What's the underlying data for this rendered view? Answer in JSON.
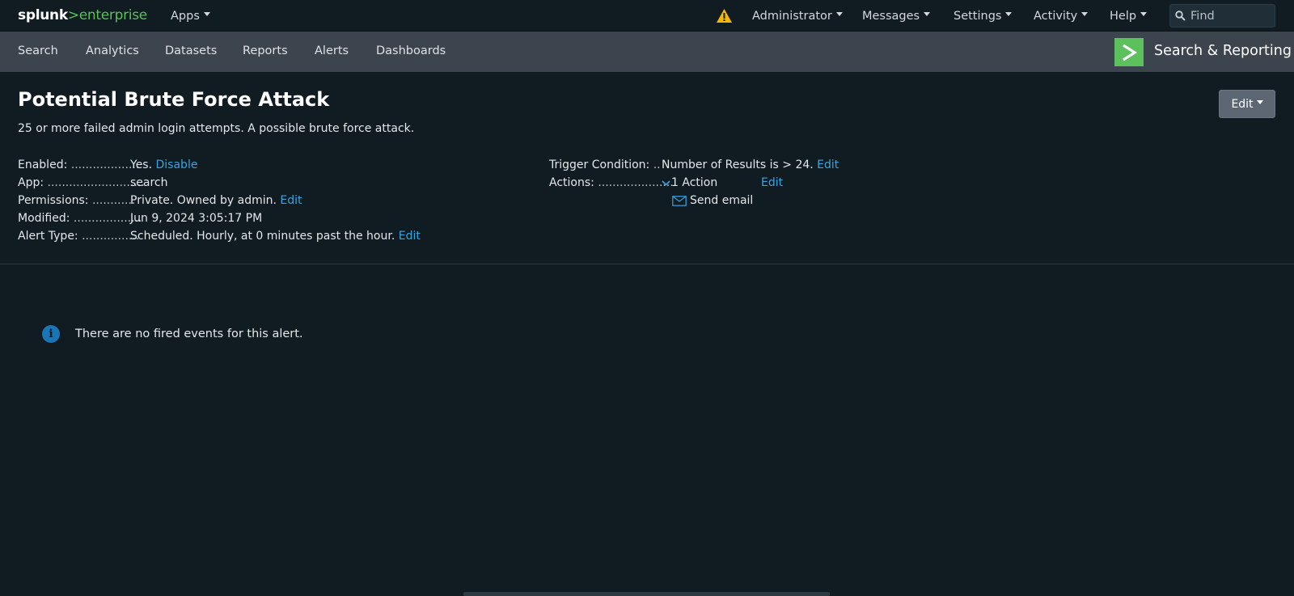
{
  "topbar": {
    "logo_part1": "splunk",
    "logo_part2": ">enterprise",
    "apps": "Apps",
    "administrator": "Administrator",
    "messages": "Messages",
    "settings": "Settings",
    "activity": "Activity",
    "help": "Help",
    "find_placeholder": "Find"
  },
  "appnav": {
    "items": [
      "Search",
      "Analytics",
      "Datasets",
      "Reports",
      "Alerts",
      "Dashboards"
    ],
    "app_title": "Search & Reporting"
  },
  "alert": {
    "title": "Potential Brute Force Attack",
    "description": "25 or more failed admin login attempts. A possible brute force attack.",
    "edit_button": "Edit",
    "enabled_label": "Enabled:",
    "enabled_dots": "...................",
    "enabled_value": "Yes.",
    "enabled_link": "Disable",
    "app_label": "App:",
    "app_dots": "...........................",
    "app_value": "search",
    "permissions_label": "Permissions:",
    "permissions_dots": "............",
    "permissions_value": "Private. Owned by admin.",
    "permissions_link": "Edit",
    "modified_label": "Modified:",
    "modified_dots": "...................",
    "modified_value": "Jun 9, 2024 3:05:17 PM",
    "alerttype_label": "Alert Type:",
    "alerttype_dots": "................",
    "alerttype_value": "Scheduled. Hourly, at 0 minutes past the hour.",
    "alerttype_link": "Edit",
    "trigger_label": "Trigger Condition:",
    "trigger_dots": "..",
    "trigger_value": "Number of Results is > 24.",
    "trigger_link": "Edit",
    "actions_label": "Actions:",
    "actions_dots": ".....................",
    "actions_value": "1 Action",
    "actions_link": "Edit",
    "action_item": "Send email"
  },
  "message": {
    "text": "There are no fired events for this alert.",
    "icon": "info-icon"
  },
  "colors": {
    "background": "#101b22",
    "appbar": "#3c444d",
    "brand_green": "#5cc05c",
    "link": "#3aa4e0",
    "warning": "#f5b800"
  }
}
